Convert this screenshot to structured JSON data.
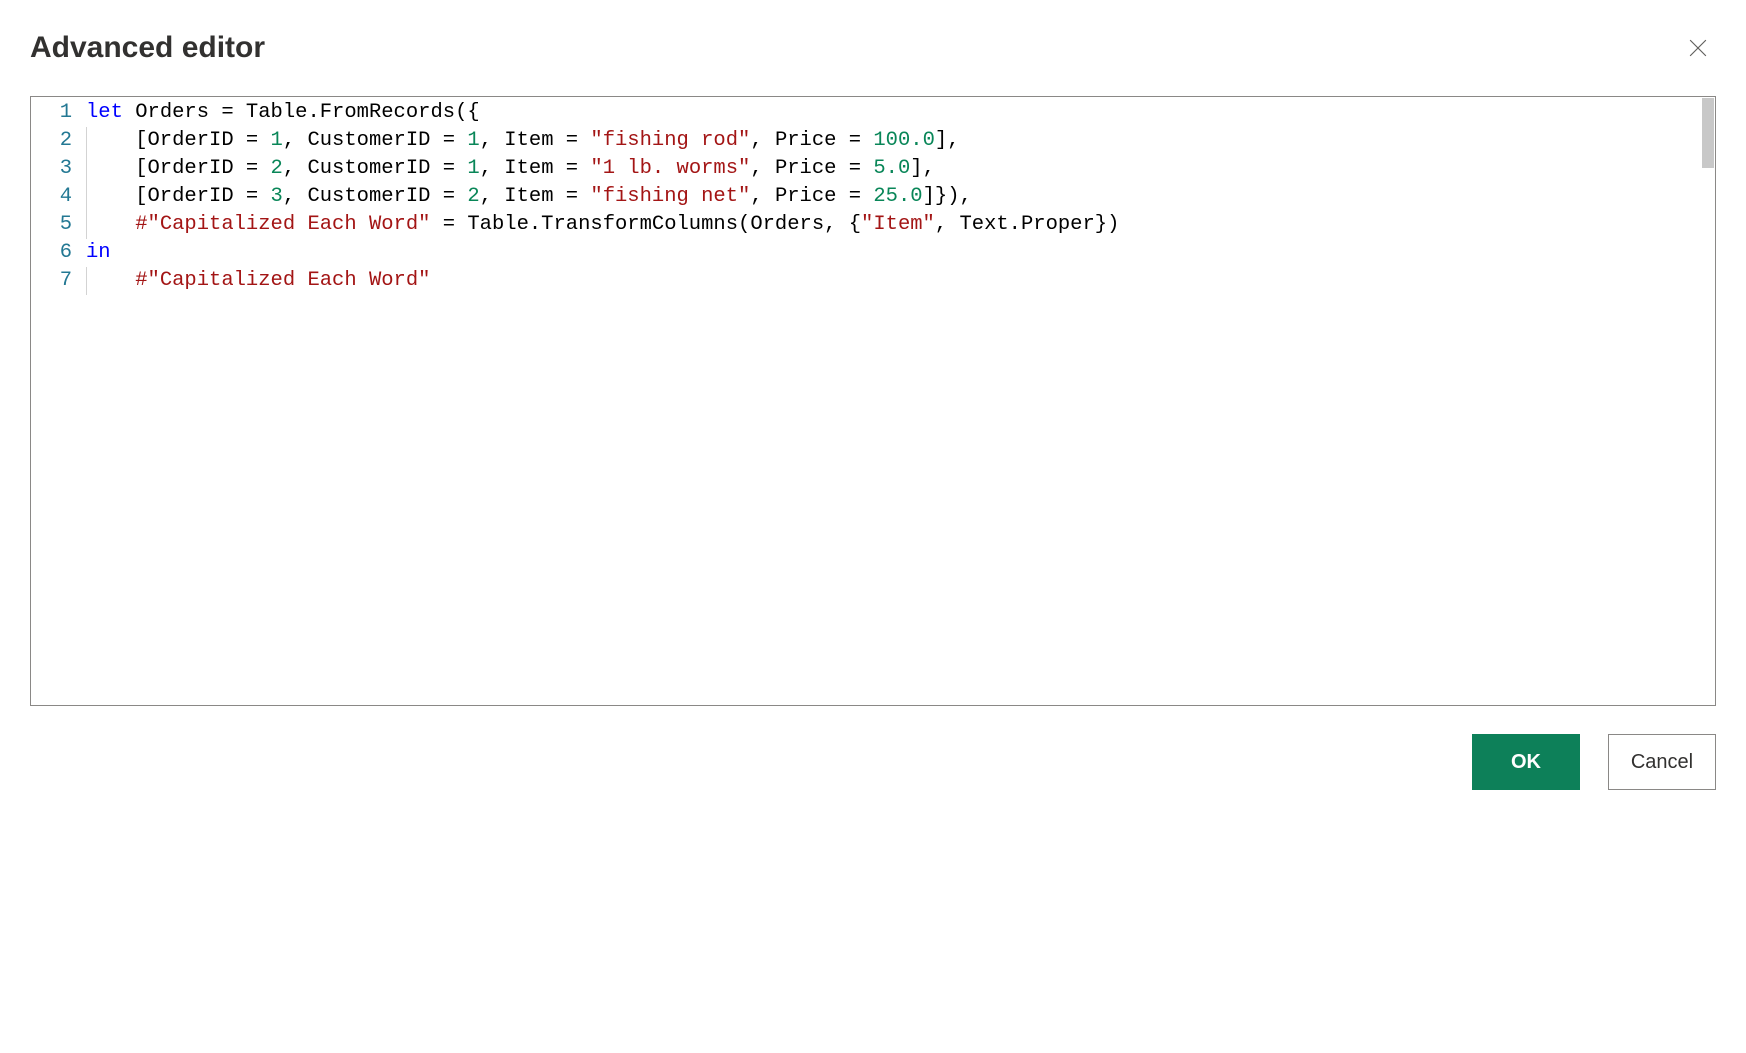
{
  "header": {
    "title": "Advanced editor"
  },
  "editor": {
    "lines": [
      {
        "num": "1",
        "indent": 0,
        "tokens": [
          {
            "cls": "tok-keyword",
            "t": "let"
          },
          {
            "cls": "tok-punct",
            "t": " "
          },
          {
            "cls": "tok-ident",
            "t": "Orders = Table.FromRecords({"
          }
        ]
      },
      {
        "num": "2",
        "indent": 1,
        "tokens": [
          {
            "cls": "tok-ident",
            "t": "    [OrderID = "
          },
          {
            "cls": "tok-num",
            "t": "1"
          },
          {
            "cls": "tok-ident",
            "t": ", CustomerID = "
          },
          {
            "cls": "tok-num",
            "t": "1"
          },
          {
            "cls": "tok-ident",
            "t": ", Item = "
          },
          {
            "cls": "tok-str",
            "t": "\"fishing rod\""
          },
          {
            "cls": "tok-ident",
            "t": ", Price = "
          },
          {
            "cls": "tok-num",
            "t": "100.0"
          },
          {
            "cls": "tok-ident",
            "t": "],"
          }
        ]
      },
      {
        "num": "3",
        "indent": 1,
        "tokens": [
          {
            "cls": "tok-ident",
            "t": "    [OrderID = "
          },
          {
            "cls": "tok-num",
            "t": "2"
          },
          {
            "cls": "tok-ident",
            "t": ", CustomerID = "
          },
          {
            "cls": "tok-num",
            "t": "1"
          },
          {
            "cls": "tok-ident",
            "t": ", Item = "
          },
          {
            "cls": "tok-str",
            "t": "\"1 lb. worms\""
          },
          {
            "cls": "tok-ident",
            "t": ", Price = "
          },
          {
            "cls": "tok-num",
            "t": "5.0"
          },
          {
            "cls": "tok-ident",
            "t": "],"
          }
        ]
      },
      {
        "num": "4",
        "indent": 1,
        "tokens": [
          {
            "cls": "tok-ident",
            "t": "    [OrderID = "
          },
          {
            "cls": "tok-num",
            "t": "3"
          },
          {
            "cls": "tok-ident",
            "t": ", CustomerID = "
          },
          {
            "cls": "tok-num",
            "t": "2"
          },
          {
            "cls": "tok-ident",
            "t": ", Item = "
          },
          {
            "cls": "tok-str",
            "t": "\"fishing net\""
          },
          {
            "cls": "tok-ident",
            "t": ", Price = "
          },
          {
            "cls": "tok-num",
            "t": "25.0"
          },
          {
            "cls": "tok-ident",
            "t": "]}),"
          }
        ]
      },
      {
        "num": "5",
        "indent": 1,
        "tokens": [
          {
            "cls": "tok-ident",
            "t": "    "
          },
          {
            "cls": "tok-escstr",
            "t": "#\"Capitalized Each Word\""
          },
          {
            "cls": "tok-ident",
            "t": " = Table.TransformColumns(Orders, {"
          },
          {
            "cls": "tok-str",
            "t": "\"Item\""
          },
          {
            "cls": "tok-ident",
            "t": ", Text.Proper})"
          }
        ]
      },
      {
        "num": "6",
        "indent": 0,
        "tokens": [
          {
            "cls": "tok-keyword",
            "t": "in"
          }
        ]
      },
      {
        "num": "7",
        "indent": 1,
        "tokens": [
          {
            "cls": "tok-ident",
            "t": "    "
          },
          {
            "cls": "tok-escstr",
            "t": "#\"Capitalized Each Word\""
          }
        ]
      }
    ]
  },
  "footer": {
    "ok_label": "OK",
    "cancel_label": "Cancel"
  }
}
